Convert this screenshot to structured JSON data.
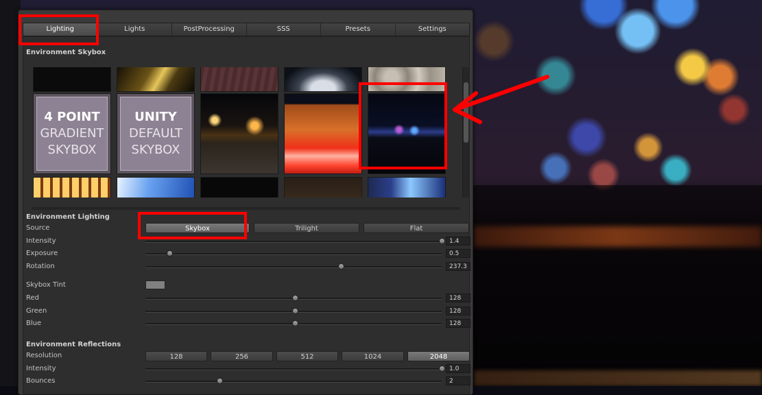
{
  "tabs": [
    "Lighting",
    "Lights",
    "PostProcessing",
    "SSS",
    "Presets",
    "Settings"
  ],
  "active_tab": "Lighting",
  "skybox": {
    "title": "Environment Skybox",
    "tiles": [
      {
        "name": "skybox-thumb-dark",
        "lines": []
      },
      {
        "name": "skybox-thumb-tunnel-lights",
        "lines": []
      },
      {
        "name": "skybox-thumb-brick",
        "lines": []
      },
      {
        "name": "skybox-thumb-night-arch",
        "lines": []
      },
      {
        "name": "skybox-thumb-rocky",
        "lines": []
      },
      {
        "name": "skybox-4-point-gradient",
        "lines": [
          "4 POINT",
          "GRADIENT",
          "SKYBOX"
        ]
      },
      {
        "name": "skybox-unity-default",
        "lines": [
          "UNITY",
          "DEFAULT",
          "SKYBOX"
        ]
      },
      {
        "name": "skybox-thumb-city-square",
        "lines": []
      },
      {
        "name": "skybox-thumb-red-snow-building",
        "lines": []
      },
      {
        "name": "skybox-thumb-night-harbor",
        "lines": []
      },
      {
        "name": "skybox-thumb-lit-arcade",
        "lines": []
      },
      {
        "name": "skybox-thumb-blue-sky",
        "lines": []
      },
      {
        "name": "skybox-thumb-black",
        "lines": []
      },
      {
        "name": "skybox-thumb-brown",
        "lines": []
      },
      {
        "name": "skybox-thumb-blue-interior",
        "lines": []
      }
    ],
    "selected": "skybox-thumb-night-harbor"
  },
  "lighting": {
    "title": "Environment Lighting",
    "source_label": "Source",
    "sources": [
      "Skybox",
      "Trilight",
      "Flat"
    ],
    "selected_source": "Skybox",
    "sliders": [
      {
        "label": "Intensity",
        "value": "1.4",
        "fraction": 1.0
      },
      {
        "label": "Exposure",
        "value": "0.5",
        "fraction": 0.08
      },
      {
        "label": "Rotation",
        "value": "237.3",
        "fraction": 0.66
      }
    ],
    "tint_label": "Skybox Tint",
    "tint_color": "#808080",
    "tint_sliders": [
      {
        "label": "Red",
        "value": "128",
        "fraction": 0.505
      },
      {
        "label": "Green",
        "value": "128",
        "fraction": 0.505
      },
      {
        "label": "Blue",
        "value": "128",
        "fraction": 0.505
      }
    ]
  },
  "reflections": {
    "title": "Environment Reflections",
    "resolution_label": "Resolution",
    "resolutions": [
      "128",
      "256",
      "512",
      "1024",
      "2048"
    ],
    "selected_resolution": "2048",
    "sliders": [
      {
        "label": "Intensity",
        "value": "1.0",
        "fraction": 1.0
      },
      {
        "label": "Bounces",
        "value": "2",
        "fraction": 0.25
      }
    ]
  },
  "annotation_color": "#ff0000"
}
